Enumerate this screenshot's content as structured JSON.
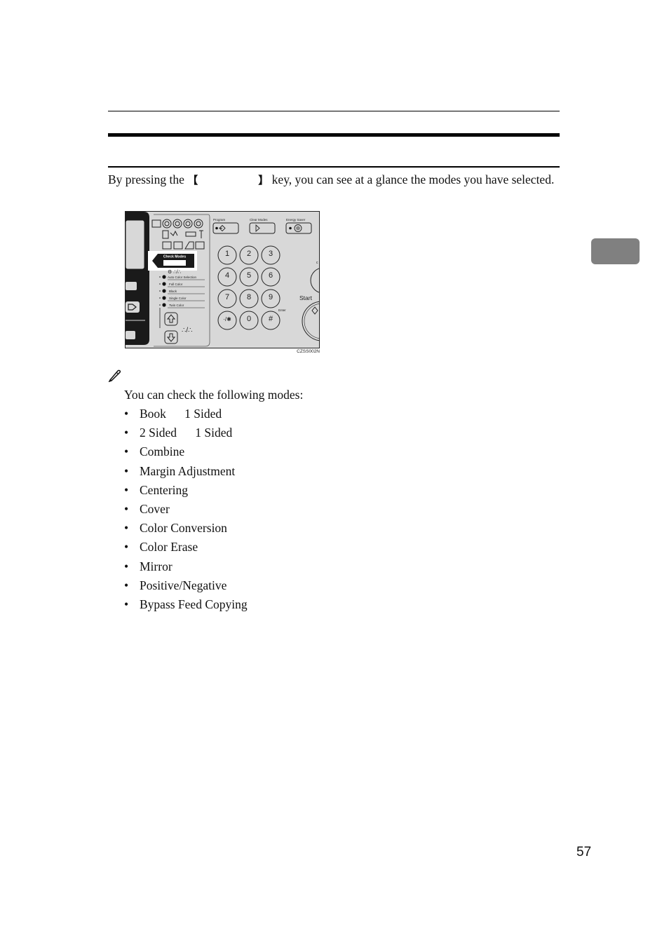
{
  "intro": {
    "before": "By pressing the ",
    "open_bracket": "【",
    "close_bracket": "】",
    "after": " key, you can see at a glance the modes you have selected."
  },
  "figure": {
    "code": "CZSS002N",
    "callout_label": "Check Modes",
    "top_buttons": [
      {
        "label": "Program"
      },
      {
        "label": "Clear Modes"
      },
      {
        "label": "Energy Saver"
      }
    ],
    "keypad": [
      "1",
      "2",
      "3",
      "4",
      "5",
      "6",
      "7",
      "8",
      "9",
      "·/✱",
      "0",
      "#"
    ],
    "enter_label": "Enter",
    "start_label": "Start",
    "color_modes": [
      "Auto Color Selection",
      "Full Color",
      "Black",
      "Single Color",
      "Twin Color"
    ]
  },
  "note": {
    "icon": "pencil-note-icon",
    "text": "You can check the following modes:"
  },
  "modes": [
    "Book      1 Sided",
    "2 Sided      1 Sided",
    "Combine",
    "Margin Adjustment",
    "Centering",
    "Cover",
    "Color Conversion",
    "Color Erase",
    "Mirror",
    "Positive/Negative",
    "Bypass Feed Copying"
  ],
  "page_number": "57",
  "colors": {
    "tab_marker": "#808080",
    "panel_bg": "#d8d8d8"
  }
}
